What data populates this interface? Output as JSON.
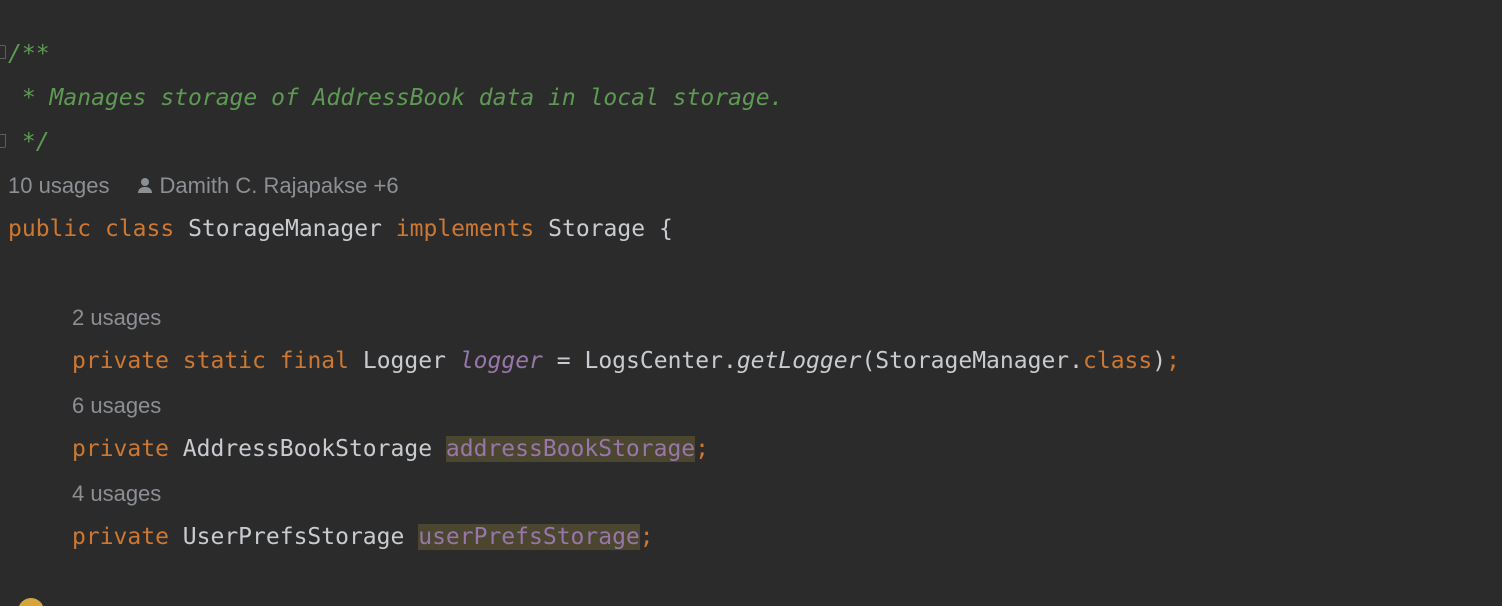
{
  "doc_comment": {
    "open": "/**",
    "text": " * Manages storage of AddressBook data in local storage.",
    "close": " */"
  },
  "class_hint": {
    "usages": "10 usages",
    "author": "Damith C. Rajapakse +6"
  },
  "class_decl": {
    "kw_public": "public",
    "kw_class": "class",
    "name": "StorageManager",
    "kw_implements": "implements",
    "interface": "Storage",
    "brace": "{"
  },
  "field_logger": {
    "usages": "2 usages",
    "kw_private": "private",
    "kw_static": "static",
    "kw_final": "final",
    "type": "Logger",
    "name": "logger",
    "eq": "=",
    "call_owner": "LogsCenter.",
    "call_method": "getLogger",
    "arg_open": "(StorageManager.",
    "arg_kw": "class",
    "arg_close": ")",
    "semi": ";"
  },
  "field_address": {
    "usages": "6 usages",
    "kw_private": "private",
    "type": "AddressBookStorage",
    "name": "addressBookStorage",
    "semi": ";"
  },
  "field_prefs": {
    "usages": "4 usages",
    "kw_private": "private",
    "type": "UserPrefsStorage",
    "name": "userPrefsStorage",
    "semi": ";"
  },
  "colors": {
    "background": "#2b2b2b",
    "keyword": "#cc7832",
    "doc_comment": "#5f9a55",
    "field": "#9876aa",
    "identifier": "#c8cbd0",
    "hint": "#8c8f94",
    "highlight": "#4a4630"
  },
  "icons": [
    "fold-marker-icon",
    "person-icon",
    "lightbulb-icon"
  ]
}
